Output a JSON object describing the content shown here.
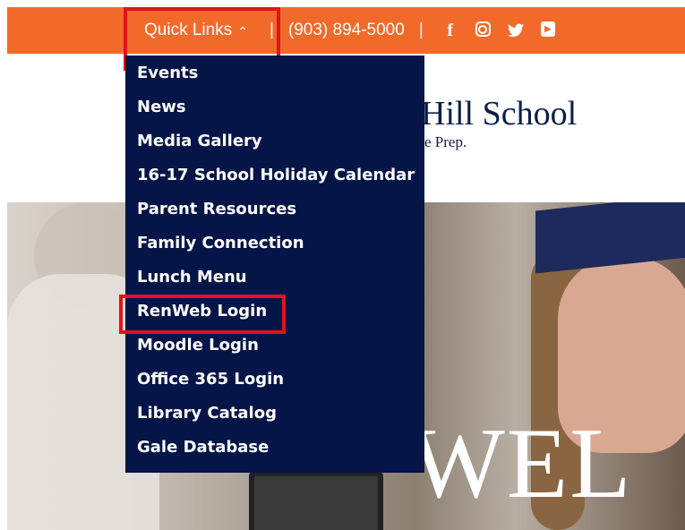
{
  "topbar": {
    "quick_links_label": "Quick Links",
    "quick_links_chevron": "^",
    "separator": "|",
    "phone": "(903) 894-5000",
    "social": [
      "facebook-icon",
      "instagram-icon",
      "twitter-icon",
      "youtube-icon"
    ],
    "social_glyphs": {
      "facebook": "f",
      "twitter": "🐦",
      "youtube": "▶"
    },
    "bg_color": "#f26a2a"
  },
  "logo": {
    "main": "Hill School",
    "sub": "e Prep."
  },
  "hero": {
    "welcome_text": "WEL"
  },
  "dropdown": {
    "bg_color": "#061547",
    "items": [
      {
        "label": "Events"
      },
      {
        "label": "News"
      },
      {
        "label": "Media Gallery"
      },
      {
        "label": "16-17 School Holiday Calendar"
      },
      {
        "label": "Parent Resources"
      },
      {
        "label": "Family Connection"
      },
      {
        "label": "Lunch Menu"
      },
      {
        "label": "RenWeb Login"
      },
      {
        "label": "Moodle Login"
      },
      {
        "label": "Office 365 Login"
      },
      {
        "label": "Library Catalog"
      },
      {
        "label": "Gale Database"
      }
    ]
  },
  "highlight_color": "#e3121b"
}
